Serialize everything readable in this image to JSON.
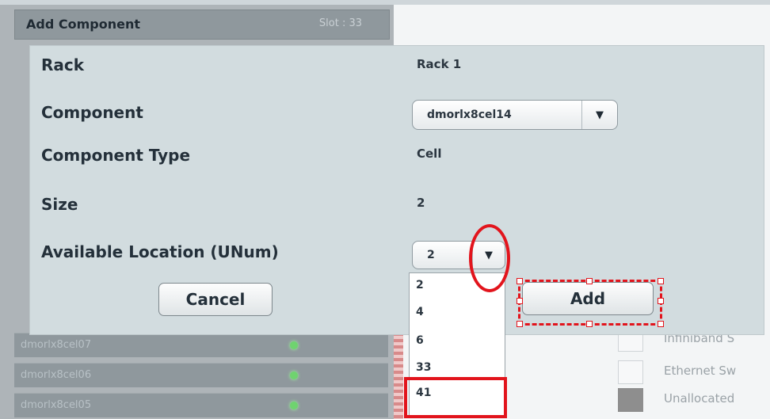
{
  "panel": {
    "title": "Add Component",
    "slot": "Slot : 33",
    "rows": [
      {
        "label": ""
      },
      {
        "label": ""
      },
      {
        "label": ""
      },
      {
        "label": ""
      },
      {
        "label": ""
      },
      {
        "label": ""
      },
      {
        "label": ""
      },
      {
        "label": "dmorlx8cel07"
      },
      {
        "label": "dmorlx8cel06"
      },
      {
        "label": "dmorlx8cel05"
      }
    ]
  },
  "legend": {
    "items": [
      {
        "label": "Infiniband S"
      },
      {
        "label": "Ethernet Sw"
      },
      {
        "label": "Unallocated"
      }
    ]
  },
  "dialog": {
    "rack_label": "Rack",
    "rack_value": "Rack 1",
    "component_label": "Component",
    "component_value": "dmorlx8cel14",
    "component_type_label": "Component Type",
    "component_type_value": "Cell",
    "size_label": "Size",
    "size_value": "2",
    "location_label": "Available Location (UNum)",
    "location_value": "2",
    "cancel_label": "Cancel",
    "add_label": "Add",
    "location_options": [
      "2",
      "4",
      "6",
      "33",
      "41"
    ]
  },
  "icons": {
    "dropdown_arrow": "▼"
  },
  "colors": {
    "annotation": "#e2141c",
    "dialog_bg": "#d2dcdf",
    "status_led": "#6fd36f"
  }
}
